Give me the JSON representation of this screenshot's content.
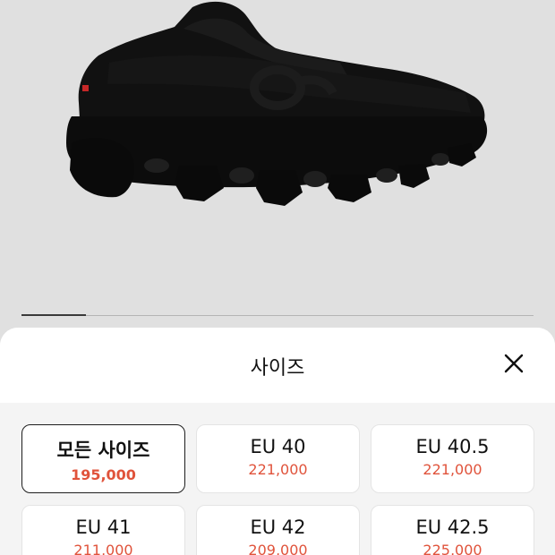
{
  "product": {
    "image_name": "black-running-shoe",
    "gallery_progress": 0.125
  },
  "size_sheet": {
    "title": "사이즈",
    "close_icon": "close-icon",
    "options": [
      {
        "size": "모든 사이즈",
        "price": "195,000",
        "selected": true
      },
      {
        "size": "EU 40",
        "price": "221,000",
        "selected": false
      },
      {
        "size": "EU 40.5",
        "price": "221,000",
        "selected": false
      },
      {
        "size": "EU 41",
        "price": "211,000",
        "selected": false
      },
      {
        "size": "EU 42",
        "price": "209,000",
        "selected": false
      },
      {
        "size": "EU 42.5",
        "price": "225,000",
        "selected": false
      }
    ]
  },
  "colors": {
    "price": "#e0533b",
    "selected_border": "#1e1e1e",
    "backdrop": "#e0e0e0"
  }
}
